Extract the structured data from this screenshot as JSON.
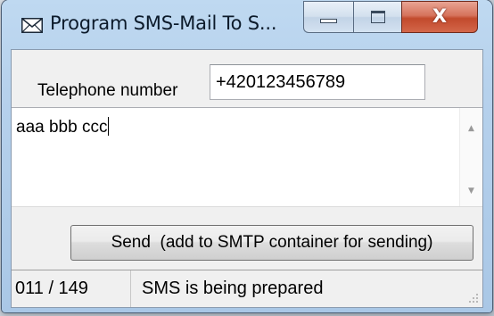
{
  "window": {
    "title": "Program SMS-Mail To S...",
    "icon": "envelope-icon",
    "buttons": {
      "minimize_icon": "minimize-icon",
      "maximize_icon": "maximize-icon",
      "close_icon": "close-icon",
      "close_glyph": "X"
    }
  },
  "form": {
    "phone_label": "Telephone number",
    "phone_value": "+420123456789",
    "message_value": "aaa bbb ccc"
  },
  "actions": {
    "send_label": "Send  (add to SMTP container for sending)"
  },
  "status": {
    "counter": "011 / 149",
    "message": "SMS is being prepared"
  },
  "colors": {
    "titlebar": "#b6d1ec",
    "close_button": "#c24a2c",
    "client_bg": "#f0f0f0"
  }
}
